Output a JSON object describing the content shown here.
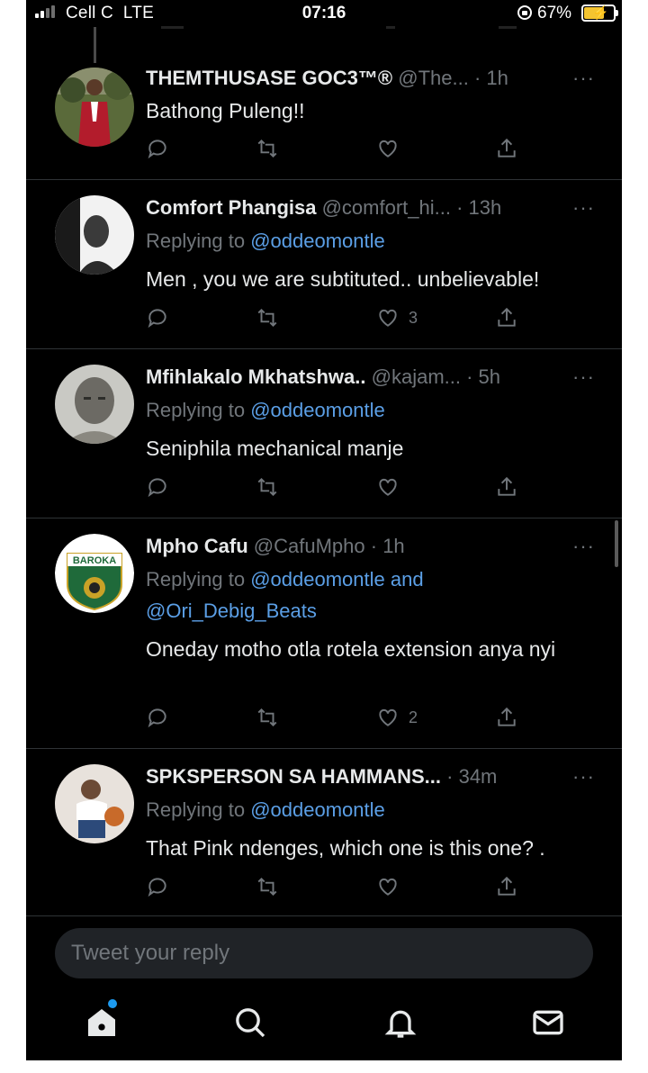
{
  "status_bar": {
    "carrier": "Cell C",
    "network": "LTE",
    "time": "07:16",
    "battery_percent": "67%",
    "battery_level": 0.67,
    "charging": true
  },
  "tweets": [
    {
      "name": "THEMTHUSASE GOC3™®",
      "handle": "@The...",
      "time": "· 1h",
      "replying_to": "",
      "text": "Bathong Puleng!!",
      "likes": "",
      "avatar": "man-in-red-suit"
    },
    {
      "name": "Comfort Phangisa",
      "handle": "@comfort_hi...",
      "time": "· 13h",
      "replying_label": "Replying to",
      "replying_to": "@oddeomontle",
      "text": "Men , you we are subtituted.. unbelievable!",
      "likes": "3",
      "avatar": "bw-portrait"
    },
    {
      "name": "Mfihlakalo Mkhatshwa..",
      "handle": "@kajam...",
      "time": "· 5h",
      "replying_label": "Replying to",
      "replying_to": "@oddeomontle",
      "text": "Seniphila mechanical manje",
      "likes": "",
      "avatar": "grey-portrait"
    },
    {
      "name": "Mpho Cafu",
      "handle": "@CafuMpho",
      "time": "· 1h",
      "replying_label": "Replying to",
      "replying_to": "@oddeomontle and",
      "replying_to_2": "@Ori_Debig_Beats",
      "text": "Oneday motho otla rotela extension anya nyi",
      "likes": "2",
      "avatar": "baroka-fc-badge",
      "badge_text": "BAROKA"
    },
    {
      "name": "SPKSPERSON SA HAMMANS...",
      "handle": "",
      "time": "· 34m",
      "replying_label": "Replying to",
      "replying_to": "@oddeomontle",
      "text": "That Pink ndenges, which one is this one? .",
      "likes": "",
      "avatar": "man-with-basketball"
    }
  ],
  "more_label": "···",
  "reply_box": {
    "placeholder": "Tweet your reply"
  },
  "tab_bar": {
    "items": [
      "home-icon",
      "search-icon",
      "bell-icon",
      "mail-icon"
    ],
    "home_has_notification_dot": true
  },
  "colors": {
    "background": "#000000",
    "text": "#e7e9ea",
    "muted": "#71767b",
    "link": "#5b9fe6",
    "accent": "#1d9bf0",
    "battery": "#f4c430"
  }
}
